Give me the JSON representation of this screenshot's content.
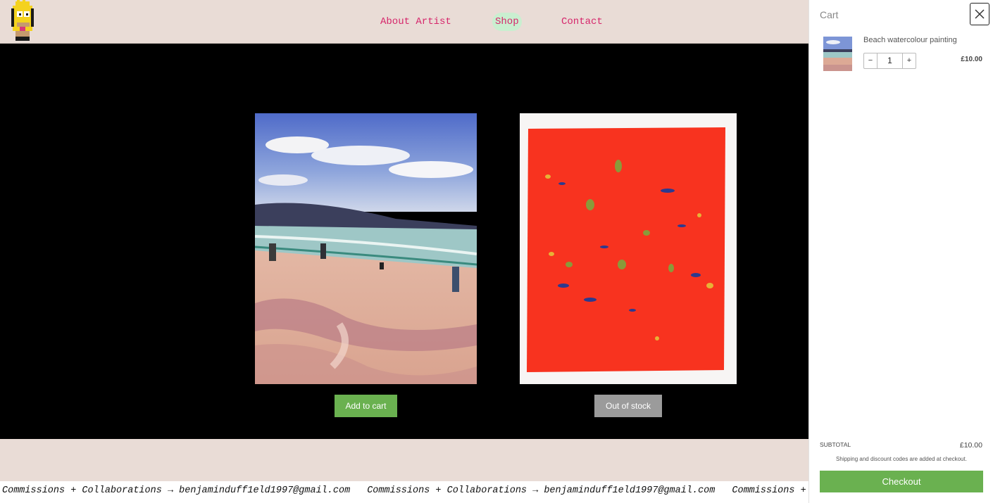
{
  "nav": {
    "about": "About Artist",
    "shop": "Shop",
    "contact": "Contact"
  },
  "products": [
    {
      "image": "beach-watercolour-painting",
      "button": "Add to cart",
      "button_state": "available",
      "button_color": "#6ab150"
    },
    {
      "image": "red-abstract-painting",
      "button": "Out of stock",
      "button_state": "disabled",
      "button_color": "#9b9b9b"
    }
  ],
  "marquee": {
    "text": "Commissions + Collaborations → benjaminduff1eld1997@gmail.com",
    "text_3": "Commissions +"
  },
  "cart": {
    "title": "Cart",
    "items": [
      {
        "name": "Beach watercolour painting",
        "quantity": "1",
        "price": "£10.00",
        "minus": "−",
        "plus": "+"
      }
    ],
    "subtotal_label": "SUBTOTAL",
    "subtotal_value": "£10.00",
    "shipping_note": "Shipping and discount codes are added at checkout.",
    "checkout_label": "Checkout"
  },
  "colors": {
    "nav_text": "#d6266b",
    "header_bg": "#e9dcd6",
    "accent_green": "#6ab150"
  }
}
